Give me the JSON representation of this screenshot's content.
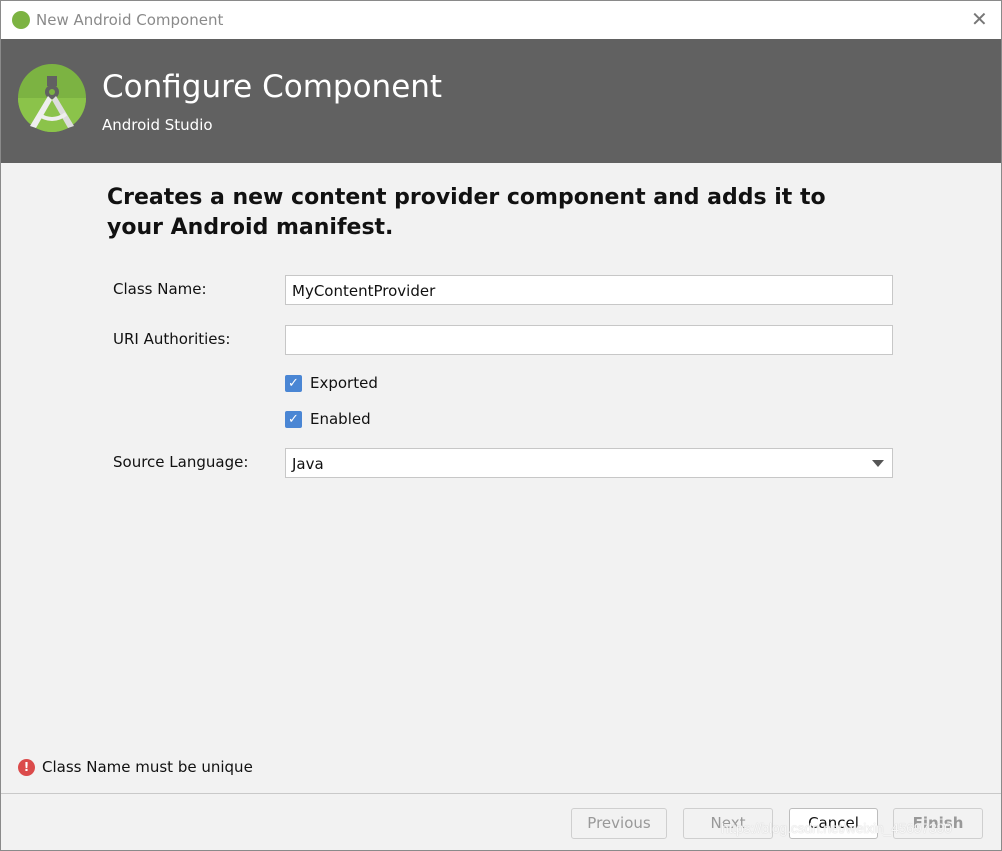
{
  "window": {
    "title": "New Android Component",
    "close_icon": "close-icon"
  },
  "header": {
    "title": "Configure Component",
    "subtitle": "Android Studio",
    "logo": "android-studio-logo"
  },
  "description": "Creates a new content provider component and adds it to your Android manifest.",
  "form": {
    "class_name": {
      "label": "Class Name:",
      "value": "MyContentProvider"
    },
    "uri_authorities": {
      "label": "URI Authorities:",
      "value": ""
    },
    "exported": {
      "label": "Exported",
      "checked": true
    },
    "enabled": {
      "label": "Enabled",
      "checked": true
    },
    "source_language": {
      "label": "Source Language:",
      "value": "Java"
    }
  },
  "error": {
    "message": "Class Name must be unique",
    "color": "#db4b4b"
  },
  "buttons": {
    "previous": "Previous",
    "next": "Next",
    "cancel": "Cancel",
    "finish": "Finish"
  },
  "watermark": "https://blog.csdn.net/weixin_45697390"
}
